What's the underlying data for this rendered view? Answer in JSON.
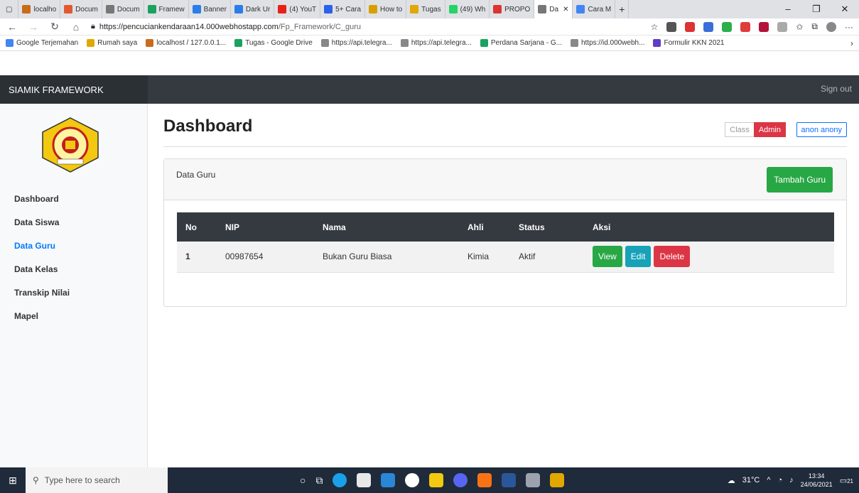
{
  "browser": {
    "tabs": [
      {
        "label": "localho",
        "color": "#c96b1a"
      },
      {
        "label": "Docum",
        "color": "#e2582f"
      },
      {
        "label": "Docum",
        "color": "#777777"
      },
      {
        "label": "Framew",
        "color": "#1aa260"
      },
      {
        "label": "Banner",
        "color": "#2b7de9"
      },
      {
        "label": "Dark Ur",
        "color": "#2b7de9"
      },
      {
        "label": "(4) YouT",
        "color": "#e62117"
      },
      {
        "label": "5+ Cara",
        "color": "#2b62e9"
      },
      {
        "label": "How to",
        "color": "#d7a000"
      },
      {
        "label": "Tugas",
        "color": "#e0a800"
      },
      {
        "label": "(49) Wh",
        "color": "#25d366"
      },
      {
        "label": "PROPO",
        "color": "#d33"
      },
      {
        "label": "Da",
        "color": "#777777"
      },
      {
        "label": "Cara M",
        "color": "#4285f4"
      }
    ],
    "url_main": "https://pencuciankendaraan14.000webhostapp.com",
    "url_path": "/Fp_Framework/C_guru",
    "bookmarks": [
      {
        "label": "Google Terjemahan",
        "color": "#4285f4"
      },
      {
        "label": "Rumah saya",
        "color": "#e0a800"
      },
      {
        "label": "localhost / 127.0.0.1...",
        "color": "#c96b1a"
      },
      {
        "label": "Tugas - Google Drive",
        "color": "#1aa260"
      },
      {
        "label": "https://api.telegra...",
        "color": "#888888"
      },
      {
        "label": "https://api.telegra...",
        "color": "#888888"
      },
      {
        "label": "Perdana Sarjana - G...",
        "color": "#1aa260"
      },
      {
        "label": "https://id.000webh...",
        "color": "#888888"
      },
      {
        "label": "Formulir KKN 2021",
        "color": "#5f3dc4"
      }
    ]
  },
  "navbar": {
    "brand": "SIAMIK FRAMEWORK",
    "signout": "Sign out"
  },
  "sidebar": {
    "items": [
      {
        "label": "Dashboard"
      },
      {
        "label": "Data Siswa"
      },
      {
        "label": "Data Guru"
      },
      {
        "label": "Data Kelas"
      },
      {
        "label": "Transkip Nilai"
      },
      {
        "label": "Mapel"
      }
    ]
  },
  "main": {
    "title": "Dashboard",
    "class_label": "Class",
    "admin_label": "Admin",
    "user_label": "anon anony",
    "card_title": "Data Guru",
    "add_button": "Tambah Guru",
    "table": {
      "headers": [
        "No",
        "NIP",
        "Nama",
        "Ahli",
        "Status",
        "Aksi"
      ],
      "rows": [
        {
          "no": "1",
          "nip": "00987654",
          "nama": "Bukan Guru Biasa",
          "ahli": "Kimia",
          "status": "Aktif"
        }
      ],
      "actions": {
        "view": "View",
        "edit": "Edit",
        "delete": "Delete"
      }
    }
  },
  "taskbar": {
    "search_placeholder": "Type here to search",
    "temperature": "31°C",
    "time": "13:34",
    "date": "24/06/2021",
    "notifications": "21"
  }
}
